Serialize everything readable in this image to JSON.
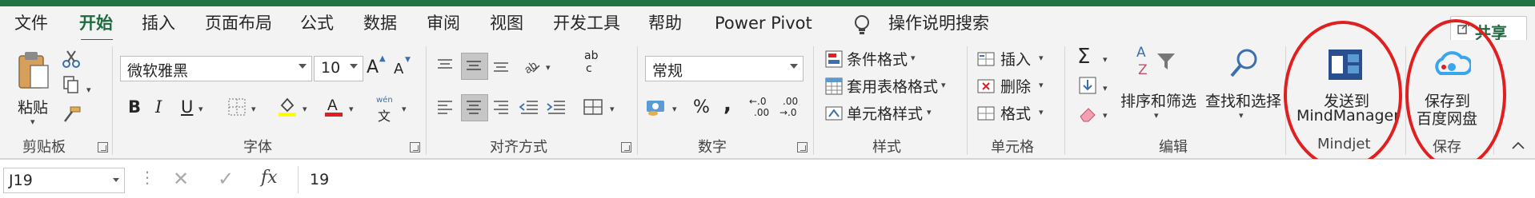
{
  "tabs": [
    "文件",
    "开始",
    "插入",
    "页面布局",
    "公式",
    "数据",
    "审阅",
    "视图",
    "开发工具",
    "帮助",
    "Power Pivot",
    "操作说明搜索"
  ],
  "active_tab": "开始",
  "share_label": "共享",
  "groups": {
    "clipboard": {
      "label": "剪贴板",
      "paste_label": "粘贴"
    },
    "font": {
      "label": "字体",
      "font_name": "微软雅黑",
      "font_size": "10",
      "grow": "A",
      "shrink": "A",
      "bold": "B",
      "italic": "I",
      "underline": "U",
      "phonetic_top": "wén",
      "phonetic_bottom": "文"
    },
    "alignment": {
      "label": "对齐方式",
      "wrap_top": "ab",
      "wrap_bottom": "c"
    },
    "number": {
      "label": "数字",
      "format": "常规",
      "percent": "%",
      "comma": ",",
      "inc_decimal": ".00",
      "dec_decimal": ".00"
    },
    "styles": {
      "label": "样式",
      "conditional": "条件格式",
      "table": "套用表格格式",
      "cell_styles": "单元格样式"
    },
    "cells": {
      "label": "单元格",
      "insert": "插入",
      "delete": "删除",
      "format": "格式"
    },
    "editing": {
      "label": "编辑",
      "sort_filter": "排序和筛选",
      "find_select": "查找和选择",
      "sigma": "Σ",
      "az_top": "A",
      "az_bottom": "Z"
    },
    "mindjet": {
      "label": "Mindjet",
      "button_line1": "发送到",
      "button_line2": "MindManager"
    },
    "save": {
      "label": "保存",
      "button_line1": "保存到",
      "button_line2": "百度网盘"
    }
  },
  "formula_bar": {
    "name_box": "J19",
    "fx": "fx",
    "value": "19"
  },
  "colors": {
    "accent": "#217346",
    "highlight_circle": "#e02020",
    "font_color_bar": "#e02020",
    "fill_color_bar": "#ffff00"
  }
}
